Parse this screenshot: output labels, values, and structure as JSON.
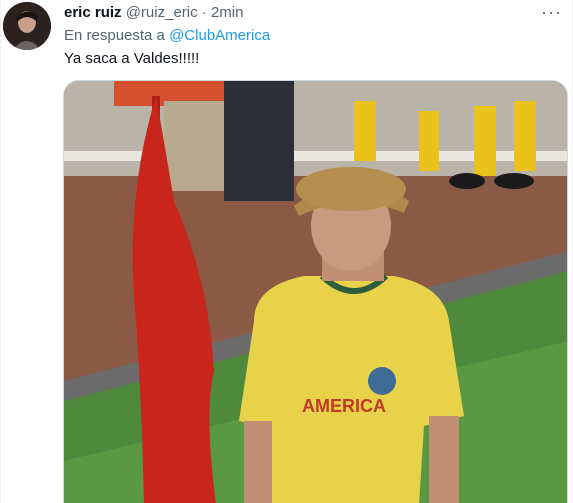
{
  "tweet": {
    "display_name": "eric ruiz",
    "handle": "@ruiz_eric",
    "separator": "·",
    "time": "2min",
    "more_icon": "more-horizontal-icon",
    "reply_prefix": "En respuesta a",
    "reply_mention": "@ClubAmerica",
    "text": "Ya saca a Valdes!!!!!",
    "media": {
      "jersey_text": "AMERICA",
      "colors": {
        "grass": "#4f8a3c",
        "dirt": "#8a5a45",
        "jersey": "#e8d24a",
        "flag": "#c8261d",
        "socks": "#e9c21c"
      }
    }
  }
}
